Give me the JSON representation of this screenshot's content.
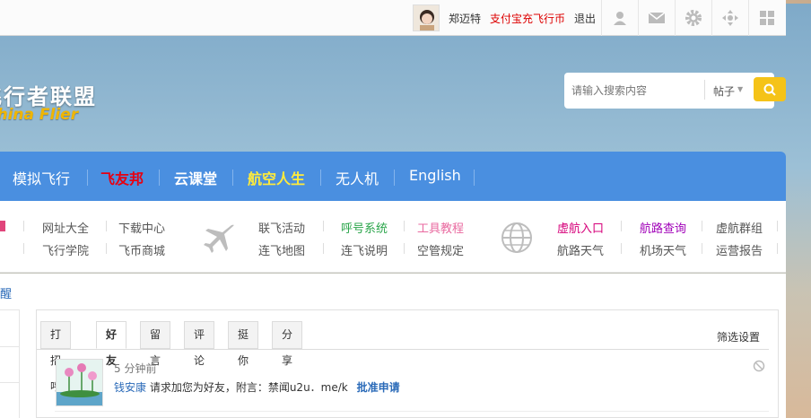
{
  "topbar": {
    "user_name": "郑迈特",
    "pay_link": "支付宝充飞行币",
    "logout": "退出",
    "icons": [
      "profile-icon",
      "mail-icon",
      "gear-icon",
      "move-icon",
      "grid-icon"
    ]
  },
  "header": {
    "logo_cn": "飞行者联盟",
    "logo_en": "China Flier",
    "search_placeholder": "请输入搜索内容",
    "search_scope": "帖子"
  },
  "nav": {
    "items": [
      "模拟飞行",
      "飞友邦",
      "云课堂",
      "航空人生",
      "无人机",
      "English"
    ]
  },
  "subnav": {
    "col1": [
      "网址大全",
      "飞行学院"
    ],
    "col2": [
      "下载中心",
      "飞币商城"
    ],
    "col3": [
      "联飞活动",
      "连飞地图"
    ],
    "col4": [
      "呼号系统",
      "连飞说明"
    ],
    "col5": [
      "工具教程",
      "空管规定"
    ],
    "col6": [
      "虚航入口",
      "航路天气"
    ],
    "col7": [
      "航路查询",
      "机场天气"
    ],
    "col8": [
      "虚航群组",
      "运营报告"
    ]
  },
  "content": {
    "breadcrumb_frag": "醒",
    "tabs": [
      "打招呼",
      "好友",
      "留言",
      "评论",
      "挺你",
      "分享"
    ],
    "active_tab": "好友",
    "filter": "筛选设置",
    "notification": {
      "time": "5 分钟前",
      "user": "钱安康",
      "message": " 请求加您为好友，附言：禁闻u2u．me/k ",
      "action": "批准申请"
    }
  },
  "colors": {
    "nav_bg": "#4a8fe0",
    "accent_red": "#d00000",
    "accent_yellow": "#f5c318",
    "link_blue": "#2a6ab8"
  }
}
